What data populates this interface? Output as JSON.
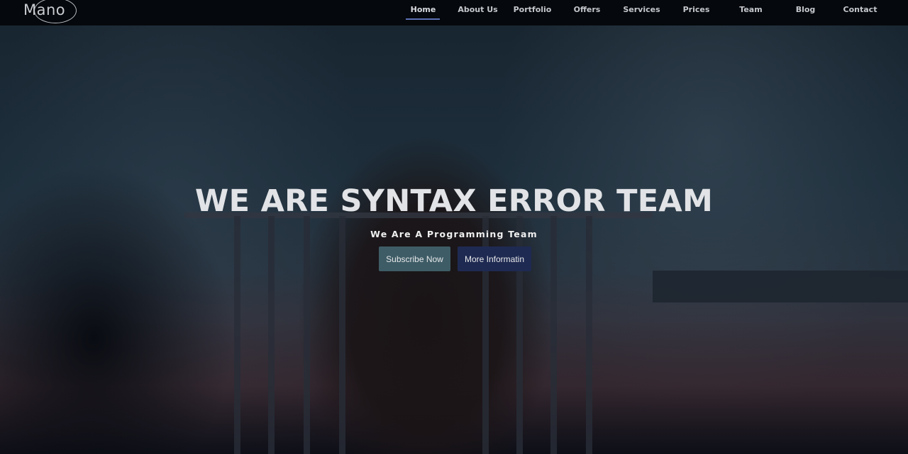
{
  "brand": {
    "logo_text": "Mano"
  },
  "nav": {
    "items": [
      {
        "label": "Home",
        "active": true
      },
      {
        "label": "About Us"
      },
      {
        "label": "Portfolio"
      },
      {
        "label": "Offers"
      },
      {
        "label": "Services"
      },
      {
        "label": "Prices"
      },
      {
        "label": "Team"
      },
      {
        "label": "Blog"
      },
      {
        "label": "Contact"
      }
    ]
  },
  "hero": {
    "title": "WE ARE SYNTAX ERROR TEAM",
    "subtitle": "We Are A Programming Team",
    "primary_button": "Subscribe Now",
    "secondary_button": "More Informatin"
  },
  "colors": {
    "accent": "#5c70b4",
    "primary_button": "#3e5c66",
    "secondary_button": "#1f2a52",
    "navbar": "#05080c"
  }
}
